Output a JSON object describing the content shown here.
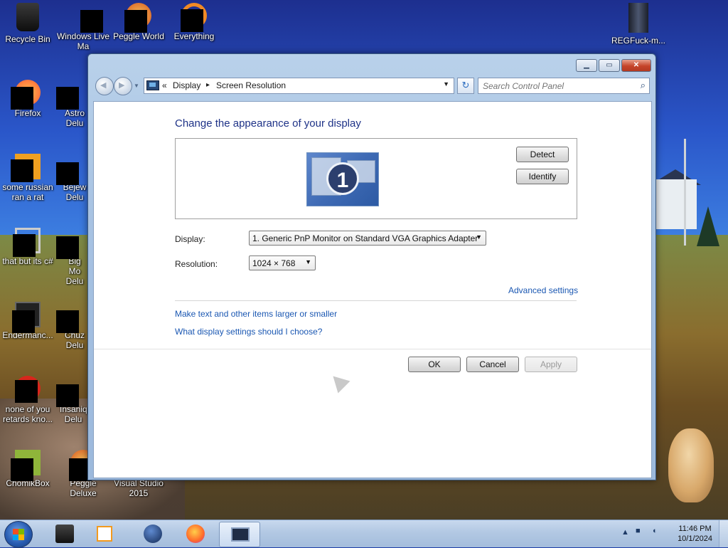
{
  "desktop": {
    "icons": [
      {
        "label": "Recycle Bin",
        "icon": "recycle-bin-icon"
      },
      {
        "label": "Windows Live Ma",
        "icon": "windows-live-icon"
      },
      {
        "label": "Peggle World",
        "icon": "peggle-world-icon"
      },
      {
        "label": "Everything",
        "icon": "everything-search-icon"
      },
      {
        "label": "REGFuck-m...",
        "icon": "folder-icon"
      },
      {
        "label": "Firefox",
        "icon": "firefox-icon"
      },
      {
        "label": "Astro Delu",
        "icon": "game-icon"
      },
      {
        "label": "some russian ran a rat",
        "icon": "executable-icon"
      },
      {
        "label": "Bejew Delu",
        "icon": "bejeweled-icon"
      },
      {
        "label": "that but its c#",
        "icon": "copy-icon"
      },
      {
        "label": "Big Mo Delu",
        "icon": "game-icon"
      },
      {
        "label": "Endermanc...",
        "icon": "app-icon"
      },
      {
        "label": "Chuz Delu",
        "icon": "game-icon"
      },
      {
        "label": "none of you retards kno...",
        "icon": "opera-icon"
      },
      {
        "label": "Insaniq Delu",
        "icon": "game-icon"
      },
      {
        "label": "ChomikBox",
        "icon": "chomikbox-icon"
      },
      {
        "label": "Peggle Deluxe",
        "icon": "peggle-icon"
      },
      {
        "label": "Visual Studio 2015",
        "icon": "visual-studio-icon"
      }
    ]
  },
  "window": {
    "breadcrumb": {
      "prefix": "«",
      "parent": "Display",
      "sep": "▸",
      "current": "Screen Resolution"
    },
    "search": {
      "placeholder": "Search Control Panel"
    },
    "heading": "Change the appearance of your display",
    "monitor_number": "1",
    "buttons": {
      "detect": "Detect",
      "identify": "Identify",
      "ok": "OK",
      "cancel": "Cancel",
      "apply": "Apply"
    },
    "fields": {
      "display_label": "Display:",
      "display_value": "1. Generic PnP Monitor on Standard VGA Graphics Adapter",
      "resolution_label": "Resolution:",
      "resolution_value": "1024 × 768"
    },
    "links": {
      "advanced": "Advanced settings",
      "text_size": "Make text and other items larger or smaller",
      "which_settings": "What display settings should I choose?"
    }
  },
  "taskbar": {
    "items": [
      "media-player-icon",
      "media-center-icon",
      "globe-icon",
      "firefox-icon",
      "display-settings-icon"
    ],
    "clock": {
      "time": "11:46 PM",
      "date": "10/1/2024"
    }
  }
}
